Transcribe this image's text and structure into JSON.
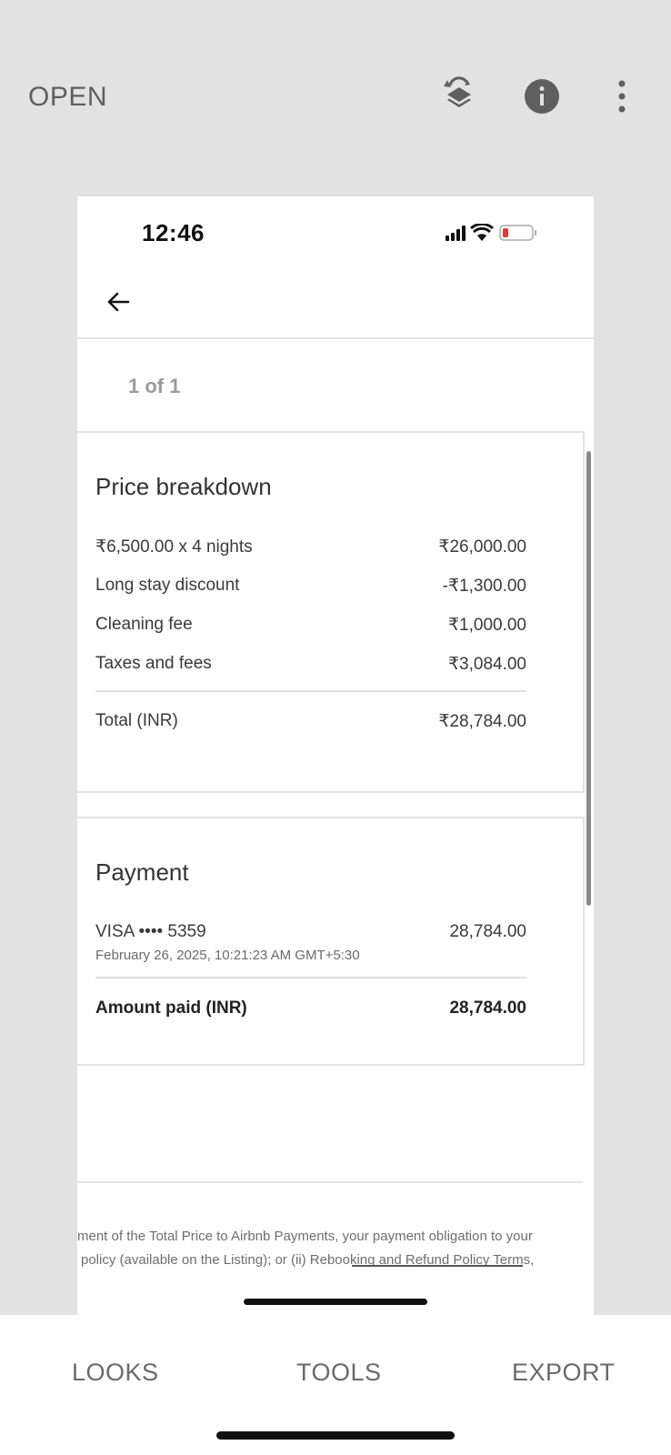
{
  "toolbar": {
    "open_label": "OPEN",
    "icons": [
      "layers-refresh-icon",
      "info-icon",
      "more-vert-icon"
    ]
  },
  "screenshot": {
    "status_time": "12:46",
    "pager": "1 of 1",
    "price_breakdown": {
      "title": "Price breakdown",
      "rows": [
        {
          "label": "₹6,500.00 x 4 nights",
          "value": "₹26,000.00"
        },
        {
          "label": "Long stay discount",
          "value": "-₹1,300.00"
        },
        {
          "label": "Cleaning fee",
          "value": "₹1,000.00"
        },
        {
          "label": "Taxes and fees",
          "value": "₹3,084.00"
        }
      ],
      "total_label": "Total (INR)",
      "total_value": "₹28,784.00"
    },
    "payment": {
      "title": "Payment",
      "card_label": "VISA •••• 5359",
      "card_value": "28,784.00",
      "date": "February 26, 2025, 10:21:23 AM GMT+5:30",
      "amount_label": "Amount paid (INR)",
      "amount_value": "28,784.00"
    },
    "fine_print": {
      "line1": "ment of the Total Price to Airbnb Payments, your payment obligation to your",
      "line2": "policy (available on the Listing); or (ii) Rebooking and Refund Policy Terms,"
    }
  },
  "bottom_nav": {
    "looks": "LOOKS",
    "tools": "TOOLS",
    "export": "EXPORT"
  },
  "colors": {
    "background": "#e2e2e2",
    "battery_low": "#e53935"
  }
}
